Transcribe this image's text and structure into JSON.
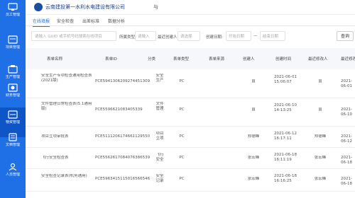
{
  "header": {
    "title": "云南建投第一水利水电建设有限公司",
    "tail": "与"
  },
  "sidebar": {
    "items": [
      {
        "label": "员工管理",
        "icon": "home-icon"
      },
      {
        "label": "项目管理",
        "icon": "project-icon"
      },
      {
        "label": "生产管理",
        "icon": "production-icon"
      },
      {
        "label": "财务管理",
        "icon": "finance-icon"
      },
      {
        "label": "物资管理",
        "icon": "material-icon"
      },
      {
        "label": "文档管理",
        "icon": "document-icon"
      },
      {
        "label": "人员管理",
        "icon": "person-icon"
      }
    ]
  },
  "tabs": [
    "在线填报",
    "安全检查",
    "出差标准",
    "数据分析"
  ],
  "filters": {
    "search_placeholder": "请输入 GUID 或手机号码搜索在线项目",
    "type_label": "所属类型:",
    "type_value": "请输入",
    "creator_label": "最近创建人:",
    "creator_value": "请选择",
    "date_label": "创建日期:",
    "date_start": "开始日期",
    "date_sep": "—",
    "date_end": "结束日期",
    "query_button": "查询"
  },
  "table": {
    "columns": [
      "表单名称",
      "表单ID",
      "分类",
      "表单类型",
      "表单来源",
      "创建人",
      "创建时间",
      "最近修改人",
      "最近修改"
    ],
    "rows": [
      {
        "name": "安全生产专项检查通用检查表(2021版)",
        "id": "PCE5941306209274451309",
        "cat": "安全生产",
        "type": "PC",
        "source": "",
        "creator": "曾",
        "ctime": "2021-06-01 15:06:07",
        "modifier": "曾",
        "mtime": "2021-06-01"
      },
      {
        "name": "文件管理日常检查表(5.1通用版)",
        "id": "PCE5596621083405339",
        "cat": "文件管理",
        "type": "PC",
        "source": "",
        "creator": "曾",
        "ctime": "2021-06-10 14:13:25",
        "modifier": "曾",
        "mtime": "2021-06-10"
      },
      {
        "name": "项目立项审批表",
        "id": "PCE5111206174661129550",
        "cat": "项目立项",
        "type": "PC",
        "source": "",
        "creator": "郑德峰",
        "ctime": "2021-06-12 16:17:11",
        "modifier": "郑德峰",
        "mtime": "2021-06-12"
      },
      {
        "name": "飞行安全检查表",
        "id": "PCE5562617084076386539",
        "cat": "飞行安全",
        "type": "PC",
        "source": "",
        "creator": "张宏峰",
        "ctime": "2021-06-18 16:11:19",
        "modifier": "张宏峰",
        "mtime": "2021-06-18"
      },
      {
        "name": "安全检查记录表(机务通用)",
        "id": "PCE5963415115016566546",
        "cat": "安全记录",
        "type": "PC",
        "source": "",
        "creator": "张宏峰",
        "ctime": "2021-06-18 16:16:25",
        "modifier": "张宏峰",
        "mtime": "2021-06-18"
      }
    ]
  }
}
